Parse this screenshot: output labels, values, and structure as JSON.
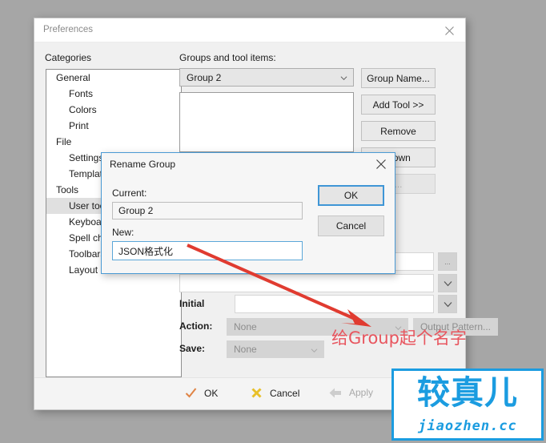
{
  "window": {
    "title": "Preferences",
    "close_icon": "close-icon"
  },
  "categories": {
    "label": "Categories",
    "items": [
      {
        "label": "General",
        "level": 0,
        "selected": false
      },
      {
        "label": "Fonts",
        "level": 1,
        "selected": false
      },
      {
        "label": "Colors",
        "level": 1,
        "selected": false
      },
      {
        "label": "Print",
        "level": 1,
        "selected": false
      },
      {
        "label": "File",
        "level": 0,
        "selected": false
      },
      {
        "label": "Settings",
        "level": 1,
        "selected": false
      },
      {
        "label": "Templates",
        "level": 1,
        "selected": false
      },
      {
        "label": "Tools",
        "level": 0,
        "selected": false
      },
      {
        "label": "User tools",
        "level": 1,
        "selected": true
      },
      {
        "label": "Keyboard",
        "level": 1,
        "selected": false
      },
      {
        "label": "Spell check",
        "level": 1,
        "selected": false
      },
      {
        "label": "Toolbars",
        "level": 1,
        "selected": false
      },
      {
        "label": "Layout",
        "level": 1,
        "selected": false
      }
    ]
  },
  "groups_panel": {
    "label": "Groups and tool items:",
    "selected_group": "Group 2",
    "dropdown_icon": "chevron-down-icon",
    "list_items": []
  },
  "side_buttons": [
    {
      "label": "Group Name...",
      "enabled": true
    },
    {
      "label": "Add Tool >>",
      "enabled": true
    },
    {
      "label": "Remove",
      "enabled": true
    },
    {
      "label": "Down",
      "enabled": true
    },
    {
      "label": "...",
      "enabled": false
    }
  ],
  "form": {
    "initial_label": "Initial",
    "action_label": "Action:",
    "action_value": "None",
    "output_pattern_label": "Output Pattern...",
    "save_label": "Save:",
    "save_value": "None",
    "mini_button_label": "...",
    "mini_dropdown_icon": "chevron-down-icon"
  },
  "bottom_bar": {
    "ok_label": "OK",
    "ok_icon": "check-icon",
    "cancel_label": "Cancel",
    "cancel_icon": "cross-icon",
    "apply_label": "Apply",
    "apply_icon": "arrow-left-icon",
    "apply_enabled": false
  },
  "rename_dialog": {
    "title": "Rename Group",
    "close_icon": "close-icon",
    "current_label": "Current:",
    "current_value": "Group 2",
    "new_label": "New:",
    "new_value": "JSON格式化",
    "ok_label": "OK",
    "cancel_label": "Cancel"
  },
  "annotation": {
    "text": "给Group起个名字",
    "color": "#e8555e",
    "arrow_icon": "arrow-pointer-icon"
  },
  "watermark": {
    "cn_text": "较真儿",
    "en_text": "jiaozhen.cc",
    "color": "#1b9ce0"
  }
}
